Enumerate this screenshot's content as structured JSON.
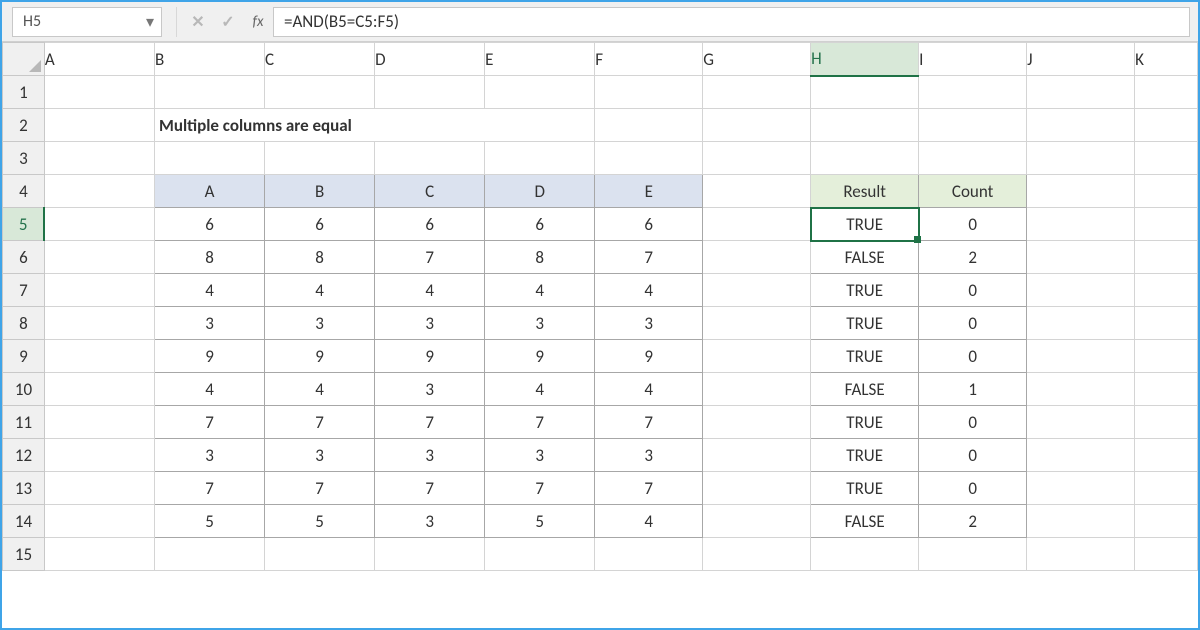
{
  "formula_bar": {
    "cell_ref": "H5",
    "fx_label": "fx",
    "formula": "=AND(B5=C5:F5)"
  },
  "icons": {
    "dropdown": "▾",
    "cancel": "✕",
    "confirm": "✓"
  },
  "columns": [
    "A",
    "B",
    "C",
    "D",
    "E",
    "F",
    "G",
    "H",
    "I",
    "J",
    "K"
  ],
  "rows": [
    "1",
    "2",
    "3",
    "4",
    "5",
    "6",
    "7",
    "8",
    "9",
    "10",
    "11",
    "12",
    "13",
    "14",
    "15"
  ],
  "title": "Multiple columns are equal",
  "data_headers": [
    "A",
    "B",
    "C",
    "D",
    "E"
  ],
  "result_headers": {
    "result": "Result",
    "count": "Count"
  },
  "data_rows": [
    {
      "a": "6",
      "b": "6",
      "c": "6",
      "d": "6",
      "e": "6",
      "result": "TRUE",
      "count": "0"
    },
    {
      "a": "8",
      "b": "8",
      "c": "7",
      "d": "8",
      "e": "7",
      "result": "FALSE",
      "count": "2"
    },
    {
      "a": "4",
      "b": "4",
      "c": "4",
      "d": "4",
      "e": "4",
      "result": "TRUE",
      "count": "0"
    },
    {
      "a": "3",
      "b": "3",
      "c": "3",
      "d": "3",
      "e": "3",
      "result": "TRUE",
      "count": "0"
    },
    {
      "a": "9",
      "b": "9",
      "c": "9",
      "d": "9",
      "e": "9",
      "result": "TRUE",
      "count": "0"
    },
    {
      "a": "4",
      "b": "4",
      "c": "3",
      "d": "4",
      "e": "4",
      "result": "FALSE",
      "count": "1"
    },
    {
      "a": "7",
      "b": "7",
      "c": "7",
      "d": "7",
      "e": "7",
      "result": "TRUE",
      "count": "0"
    },
    {
      "a": "3",
      "b": "3",
      "c": "3",
      "d": "3",
      "e": "3",
      "result": "TRUE",
      "count": "0"
    },
    {
      "a": "7",
      "b": "7",
      "c": "7",
      "d": "7",
      "e": "7",
      "result": "TRUE",
      "count": "0"
    },
    {
      "a": "5",
      "b": "5",
      "c": "3",
      "d": "5",
      "e": "4",
      "result": "FALSE",
      "count": "2"
    }
  ],
  "active": {
    "col": "H",
    "row": "5"
  }
}
